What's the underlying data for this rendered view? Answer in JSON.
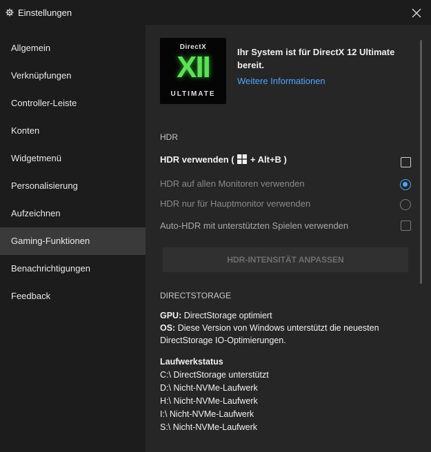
{
  "window": {
    "title": "Einstellungen",
    "title_icon": "gear-icon",
    "close_icon": "close-icon"
  },
  "sidebar": {
    "items": [
      {
        "label": "Allgemein",
        "active": false
      },
      {
        "label": "Verknüpfungen",
        "active": false
      },
      {
        "label": "Controller-Leiste",
        "active": false
      },
      {
        "label": "Konten",
        "active": false
      },
      {
        "label": "Widgetmenü",
        "active": false
      },
      {
        "label": "Personalisierung",
        "active": false
      },
      {
        "label": "Aufzeichnen",
        "active": false
      },
      {
        "label": "Gaming-Funktionen",
        "active": true
      },
      {
        "label": "Benachrichtigungen",
        "active": false
      },
      {
        "label": "Feedback",
        "active": false
      }
    ]
  },
  "directx": {
    "logo_top": "DirectX",
    "logo_main": "XII",
    "logo_bottom": "ULTIMATE",
    "status_text": "Ihr System ist für DirectX 12 Ultimate bereit.",
    "more_link": "Weitere Informationen"
  },
  "hdr": {
    "heading": "HDR",
    "use_hdr_prefix": "HDR verwenden (",
    "use_hdr_suffix": "+ Alt+B )",
    "use_hdr_checked": false,
    "all_monitors": "HDR auf allen Monitoren verwenden",
    "all_monitors_selected": true,
    "main_monitor": "HDR nur für Hauptmonitor verwenden",
    "main_monitor_selected": false,
    "auto_hdr": "Auto-HDR mit unterstützten Spielen verwenden",
    "auto_hdr_checked": false,
    "intensity_button": "HDR-INTENSITÄT ANPASSEN"
  },
  "directstorage": {
    "heading": "DIRECTSTORAGE",
    "gpu_label": "GPU:",
    "gpu_value": " DirectStorage optimiert",
    "os_label": "OS:",
    "os_value": " Diese Version von Windows unterstützt die neuesten DirectStorage IO-Optimierungen.",
    "drive_heading": "Laufwerkstatus",
    "drives": [
      "C:\\ DirectStorage unterstützt",
      "D:\\ Nicht-NVMe-Laufwerk",
      "H:\\ Nicht-NVMe-Laufwerk",
      "I:\\ Nicht-NVMe-Laufwerk",
      "S:\\ Nicht-NVMe-Laufwerk"
    ]
  },
  "colors": {
    "accent": "#4ea4ff",
    "active_nav": "#3a3a3a",
    "logo_green": "#5ee05a"
  }
}
